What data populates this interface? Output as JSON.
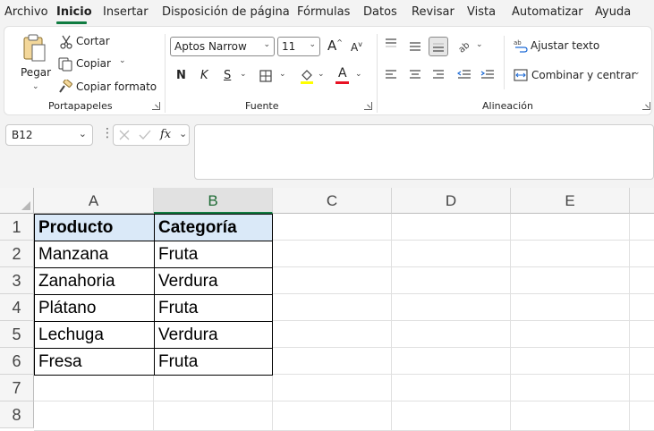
{
  "menu": {
    "tabs": [
      {
        "label": "Archivo"
      },
      {
        "label": "Inicio"
      },
      {
        "label": "Insertar"
      },
      {
        "label": "Disposición de página"
      },
      {
        "label": "Fórmulas"
      },
      {
        "label": "Datos"
      },
      {
        "label": "Revisar"
      },
      {
        "label": "Vista"
      },
      {
        "label": "Automatizar"
      },
      {
        "label": "Ayuda"
      }
    ],
    "active_tab": "Inicio"
  },
  "ribbon": {
    "clipboard": {
      "paste_label": "Pegar",
      "cut_label": "Cortar",
      "copy_label": "Copiar",
      "format_painter_label": "Copiar formato",
      "group_label": "Portapapeles"
    },
    "font": {
      "font_name": "Aptos Narrow",
      "font_size": "11",
      "bold_label": "N",
      "italic_label": "K",
      "underline_label": "S",
      "font_color_label": "A",
      "grow_label": "A",
      "shrink_label": "A",
      "group_label": "Fuente",
      "font_color": "#e81123"
    },
    "alignment": {
      "wrap_text_label": "Ajustar texto",
      "merge_center_label": "Combinar y centrar",
      "group_label": "Alineación"
    }
  },
  "formula_bar": {
    "name_box": "B12",
    "fx_label": "fx",
    "formula": ""
  },
  "sheet": {
    "columns": [
      "A",
      "B",
      "C",
      "D",
      "E"
    ],
    "selected_column": "B",
    "rows": [
      "1",
      "2",
      "3",
      "4",
      "5",
      "6",
      "7",
      "8"
    ],
    "table": {
      "headers": [
        "Producto",
        "Categoría"
      ],
      "rows": [
        [
          "Manzana",
          "Fruta"
        ],
        [
          "Zanahoria",
          "Verdura"
        ],
        [
          "Plátano",
          "Fruta"
        ],
        [
          "Lechuga",
          "Verdura"
        ],
        [
          "Fresa",
          "Fruta"
        ]
      ]
    },
    "header_fill_color": "#dae9f8",
    "accent_color": "#107c41"
  }
}
